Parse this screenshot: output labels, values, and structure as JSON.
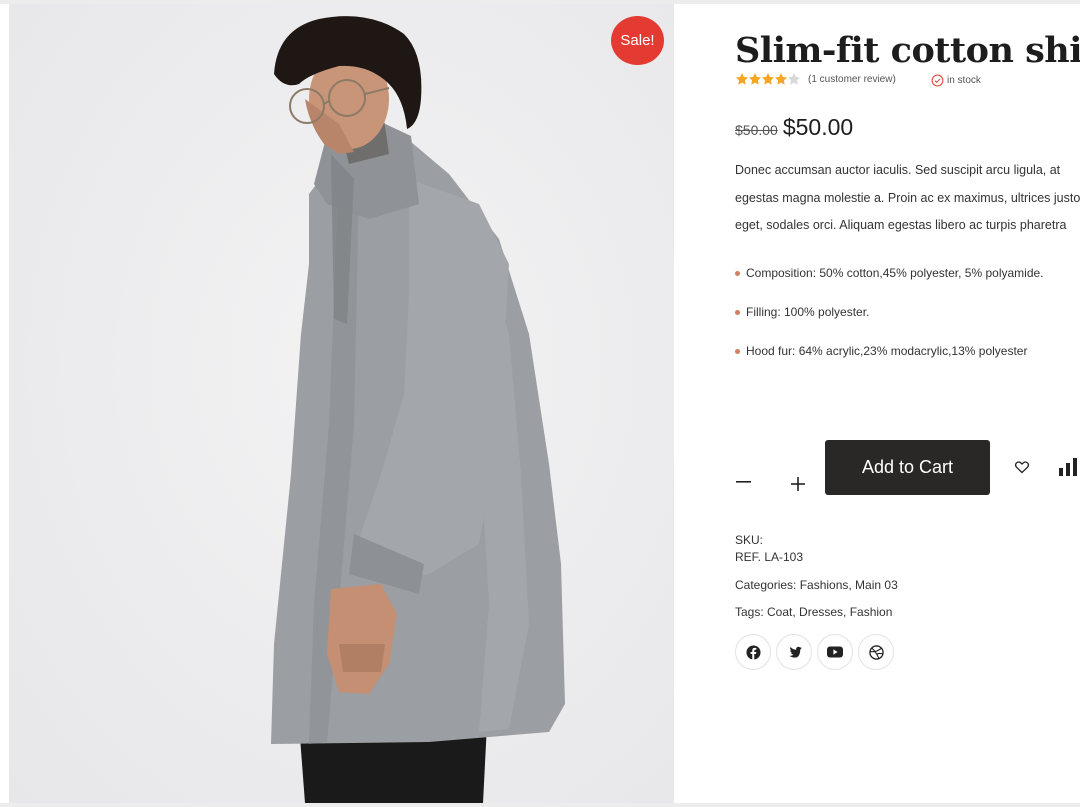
{
  "product": {
    "title": "Slim-fit cotton shirt",
    "sale_badge": "Sale!",
    "rating": 4,
    "rating_max": 5,
    "review_text": "(1 customer review)",
    "stock_text": "in stock",
    "price_old": "$50.00",
    "price_new": "$50.00",
    "description_lines": [
      "Donec accumsan auctor iaculis. Sed suscipit arcu ligula, at",
      "egestas magna molestie a. Proin ac ex maximus, ultrices justo",
      "eget, sodales orci. Aliquam egestas libero ac turpis pharetra"
    ],
    "features": [
      "Composition: 50% cotton,45% polyester, 5% polyamide.",
      "Filling: 100% polyester.",
      "Hood fur: 64% acrylic,23% modacrylic,13% polyester"
    ]
  },
  "cart": {
    "quantity": "",
    "add_label": "Add to Cart"
  },
  "meta": {
    "sku_label": "SKU:",
    "sku_value": "REF. LA-103",
    "categories": "Categories: Fashions, Main 03",
    "tags": "Tags: Coat, Dresses, Fashion"
  },
  "social": [
    "facebook-icon",
    "twitter-icon",
    "youtube-icon",
    "dribbble-icon"
  ],
  "colors": {
    "sale": "#e33a32",
    "star": "#f5a623",
    "button": "#2a2826",
    "bullet": "#d08060"
  }
}
